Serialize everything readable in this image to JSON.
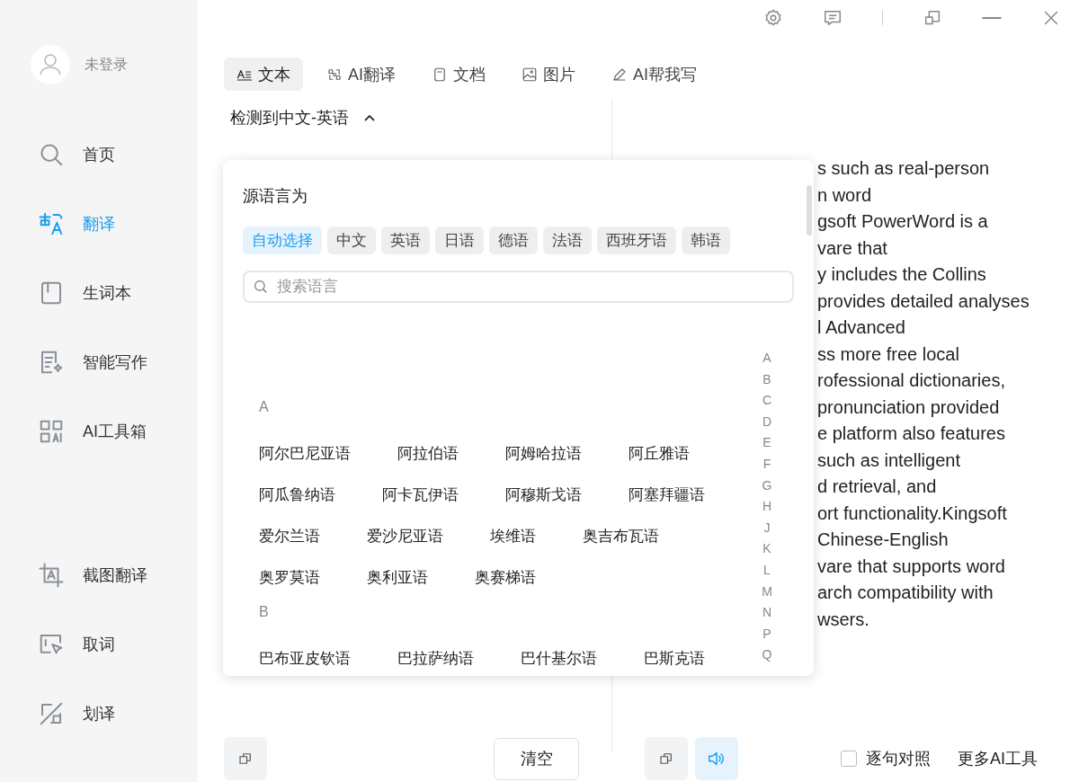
{
  "window_controls": [
    {
      "kind": "settings"
    },
    {
      "kind": "feedback"
    },
    {
      "kind": "restore"
    },
    {
      "kind": "minimize"
    },
    {
      "kind": "close"
    }
  ],
  "sidebar": {
    "user": {
      "label": "未登录"
    },
    "items": [
      {
        "label": "首页",
        "kind": "search",
        "selected": false
      },
      {
        "label": "翻译",
        "kind": "translate",
        "selected": true
      },
      {
        "label": "生词本",
        "kind": "book",
        "selected": false
      },
      {
        "label": "智能写作",
        "kind": "write",
        "selected": false
      },
      {
        "label": "AI工具箱",
        "kind": "toolbox",
        "selected": false
      }
    ],
    "tools": [
      {
        "label": "截图翻译",
        "kind": "screenshot"
      },
      {
        "label": "取词",
        "kind": "pick"
      },
      {
        "label": "划译",
        "kind": "select"
      }
    ]
  },
  "tabs": [
    {
      "label": "文本",
      "kind": "text",
      "selected": true
    },
    {
      "label": "AI翻译",
      "kind": "ai",
      "selected": false
    },
    {
      "label": "文档",
      "kind": "doc",
      "selected": false
    },
    {
      "label": "图片",
      "kind": "image",
      "selected": false
    },
    {
      "label": "AI帮我写",
      "kind": "pen",
      "selected": false
    }
  ],
  "language_toggle": {
    "label": "检测到中文-英语",
    "expanded": true
  },
  "language_popup": {
    "title": "源语言为",
    "chips": [
      {
        "label": "自动选择",
        "selected": true
      },
      {
        "label": "中文",
        "selected": false
      },
      {
        "label": "英语",
        "selected": false
      },
      {
        "label": "日语",
        "selected": false
      },
      {
        "label": "德语",
        "selected": false
      },
      {
        "label": "法语",
        "selected": false
      },
      {
        "label": "西班牙语",
        "selected": false
      },
      {
        "label": "韩语",
        "selected": false
      }
    ],
    "search": {
      "placeholder": "搜索语言"
    },
    "sections": [
      {
        "letter": "A",
        "rows": [
          [
            "阿尔巴尼亚语",
            "阿拉伯语",
            "阿姆哈拉语",
            "阿丘雅语"
          ],
          [
            "阿瓜鲁纳语",
            "阿卡瓦伊语",
            "阿穆斯戈语",
            "阿塞拜疆语"
          ],
          [
            "爱尔兰语",
            "爱沙尼亚语",
            "埃维语",
            "奥吉布瓦语"
          ],
          [
            "奥罗莫语",
            "奥利亚语",
            "奥赛梯语"
          ]
        ]
      },
      {
        "letter": "B",
        "rows": [
          [
            "巴布亚皮钦语",
            "巴拉萨纳语",
            "巴什基尔语",
            "巴斯克语"
          ]
        ]
      }
    ],
    "index": [
      "A",
      "B",
      "C",
      "D",
      "E",
      "F",
      "G",
      "H",
      "J",
      "K",
      "L",
      "M",
      "N",
      "P",
      "Q"
    ]
  },
  "translation_lines": [
    "s such as real-person",
    "n word",
    "gsoft PowerWord is a",
    "vare that",
    "y includes the Collins",
    "provides detailed analyses",
    "l Advanced",
    "ss more free local",
    "rofessional dictionaries,",
    "pronunciation provided",
    "e platform also features",
    "such as intelligent",
    "d retrieval, and",
    "ort functionality.Kingsoft",
    "Chinese-English",
    "vare that supports word",
    "arch compatibility with",
    "wsers."
  ],
  "source_actions": {
    "clear": "清空"
  },
  "target_actions": {
    "speaker_active": true,
    "sentence_compare": {
      "label": "逐句对照",
      "checked": false
    },
    "more_tools": "更多AI工具"
  }
}
